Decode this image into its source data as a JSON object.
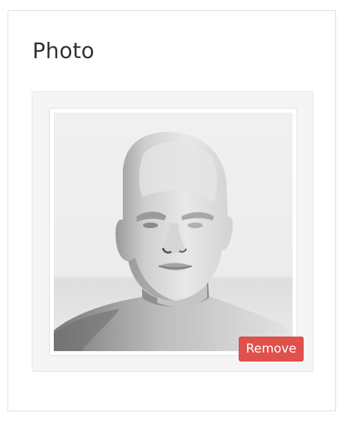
{
  "section": {
    "title": "Photo"
  },
  "photo": {
    "remove_label": "Remove"
  }
}
